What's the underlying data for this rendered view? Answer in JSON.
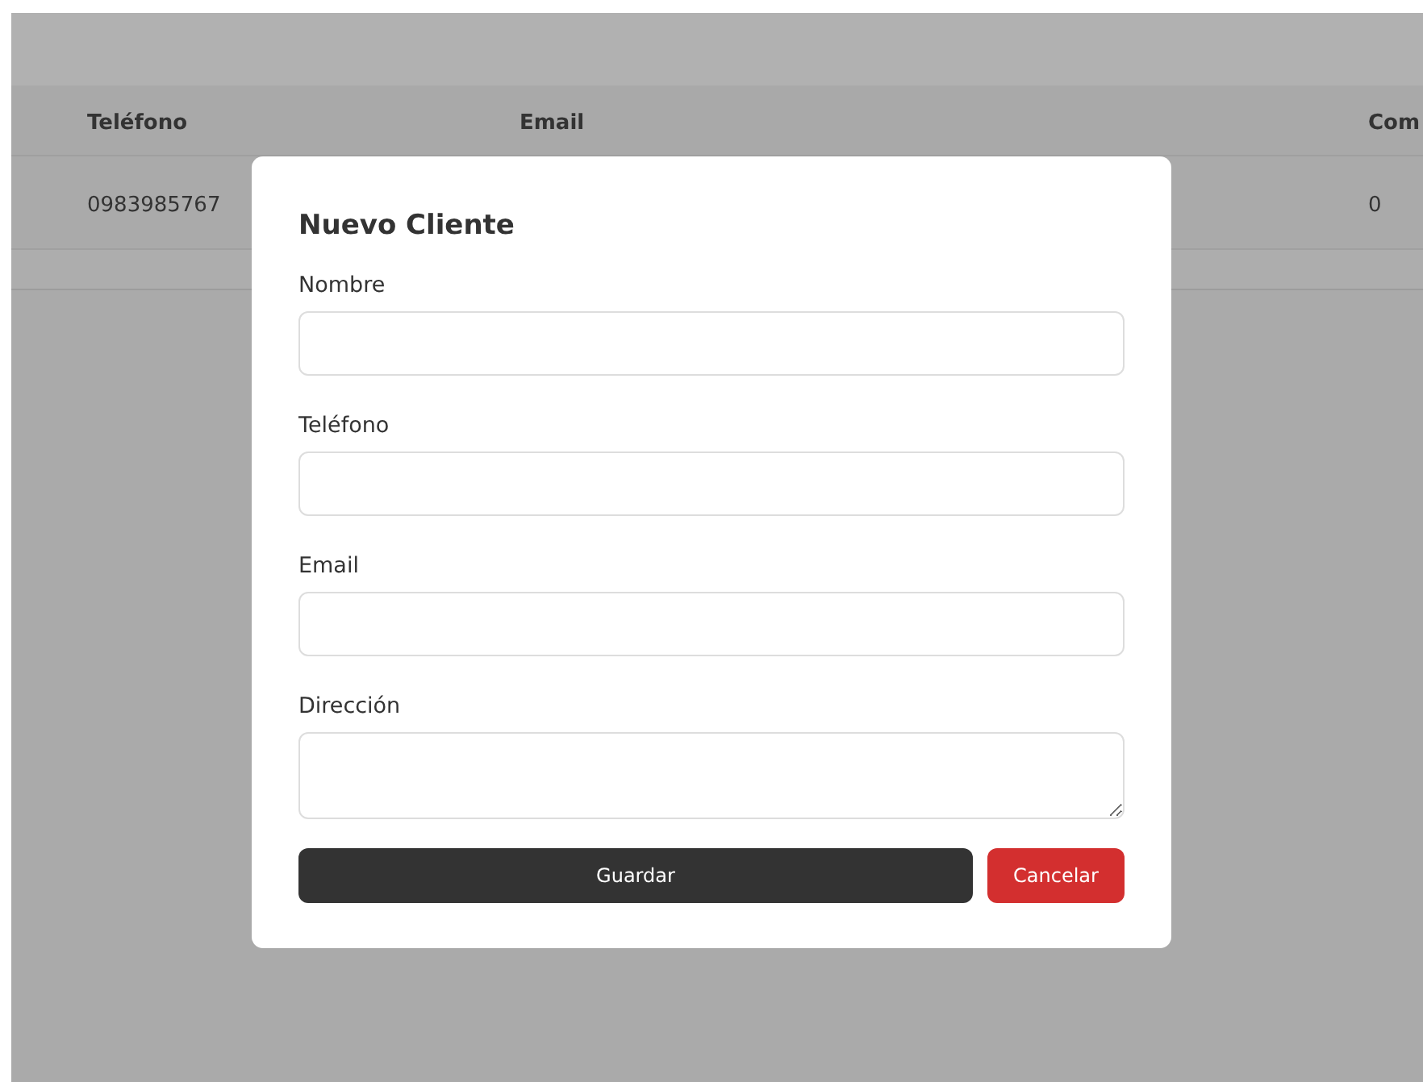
{
  "table": {
    "columns": [
      "Teléfono",
      "Email",
      "Com"
    ],
    "rows": [
      {
        "cells": [
          "0983985767",
          "",
          "0"
        ]
      }
    ]
  },
  "modal": {
    "title": "Nuevo Cliente",
    "fields": [
      {
        "label": "Nombre",
        "kind": "input"
      },
      {
        "label": "Teléfono",
        "kind": "input"
      },
      {
        "label": "Email",
        "kind": "input"
      },
      {
        "label": "Dirección",
        "kind": "textarea"
      }
    ],
    "buttons": [
      {
        "label": "Guardar",
        "kind": "primary"
      },
      {
        "label": "Cancelar",
        "kind": "danger"
      }
    ]
  }
}
